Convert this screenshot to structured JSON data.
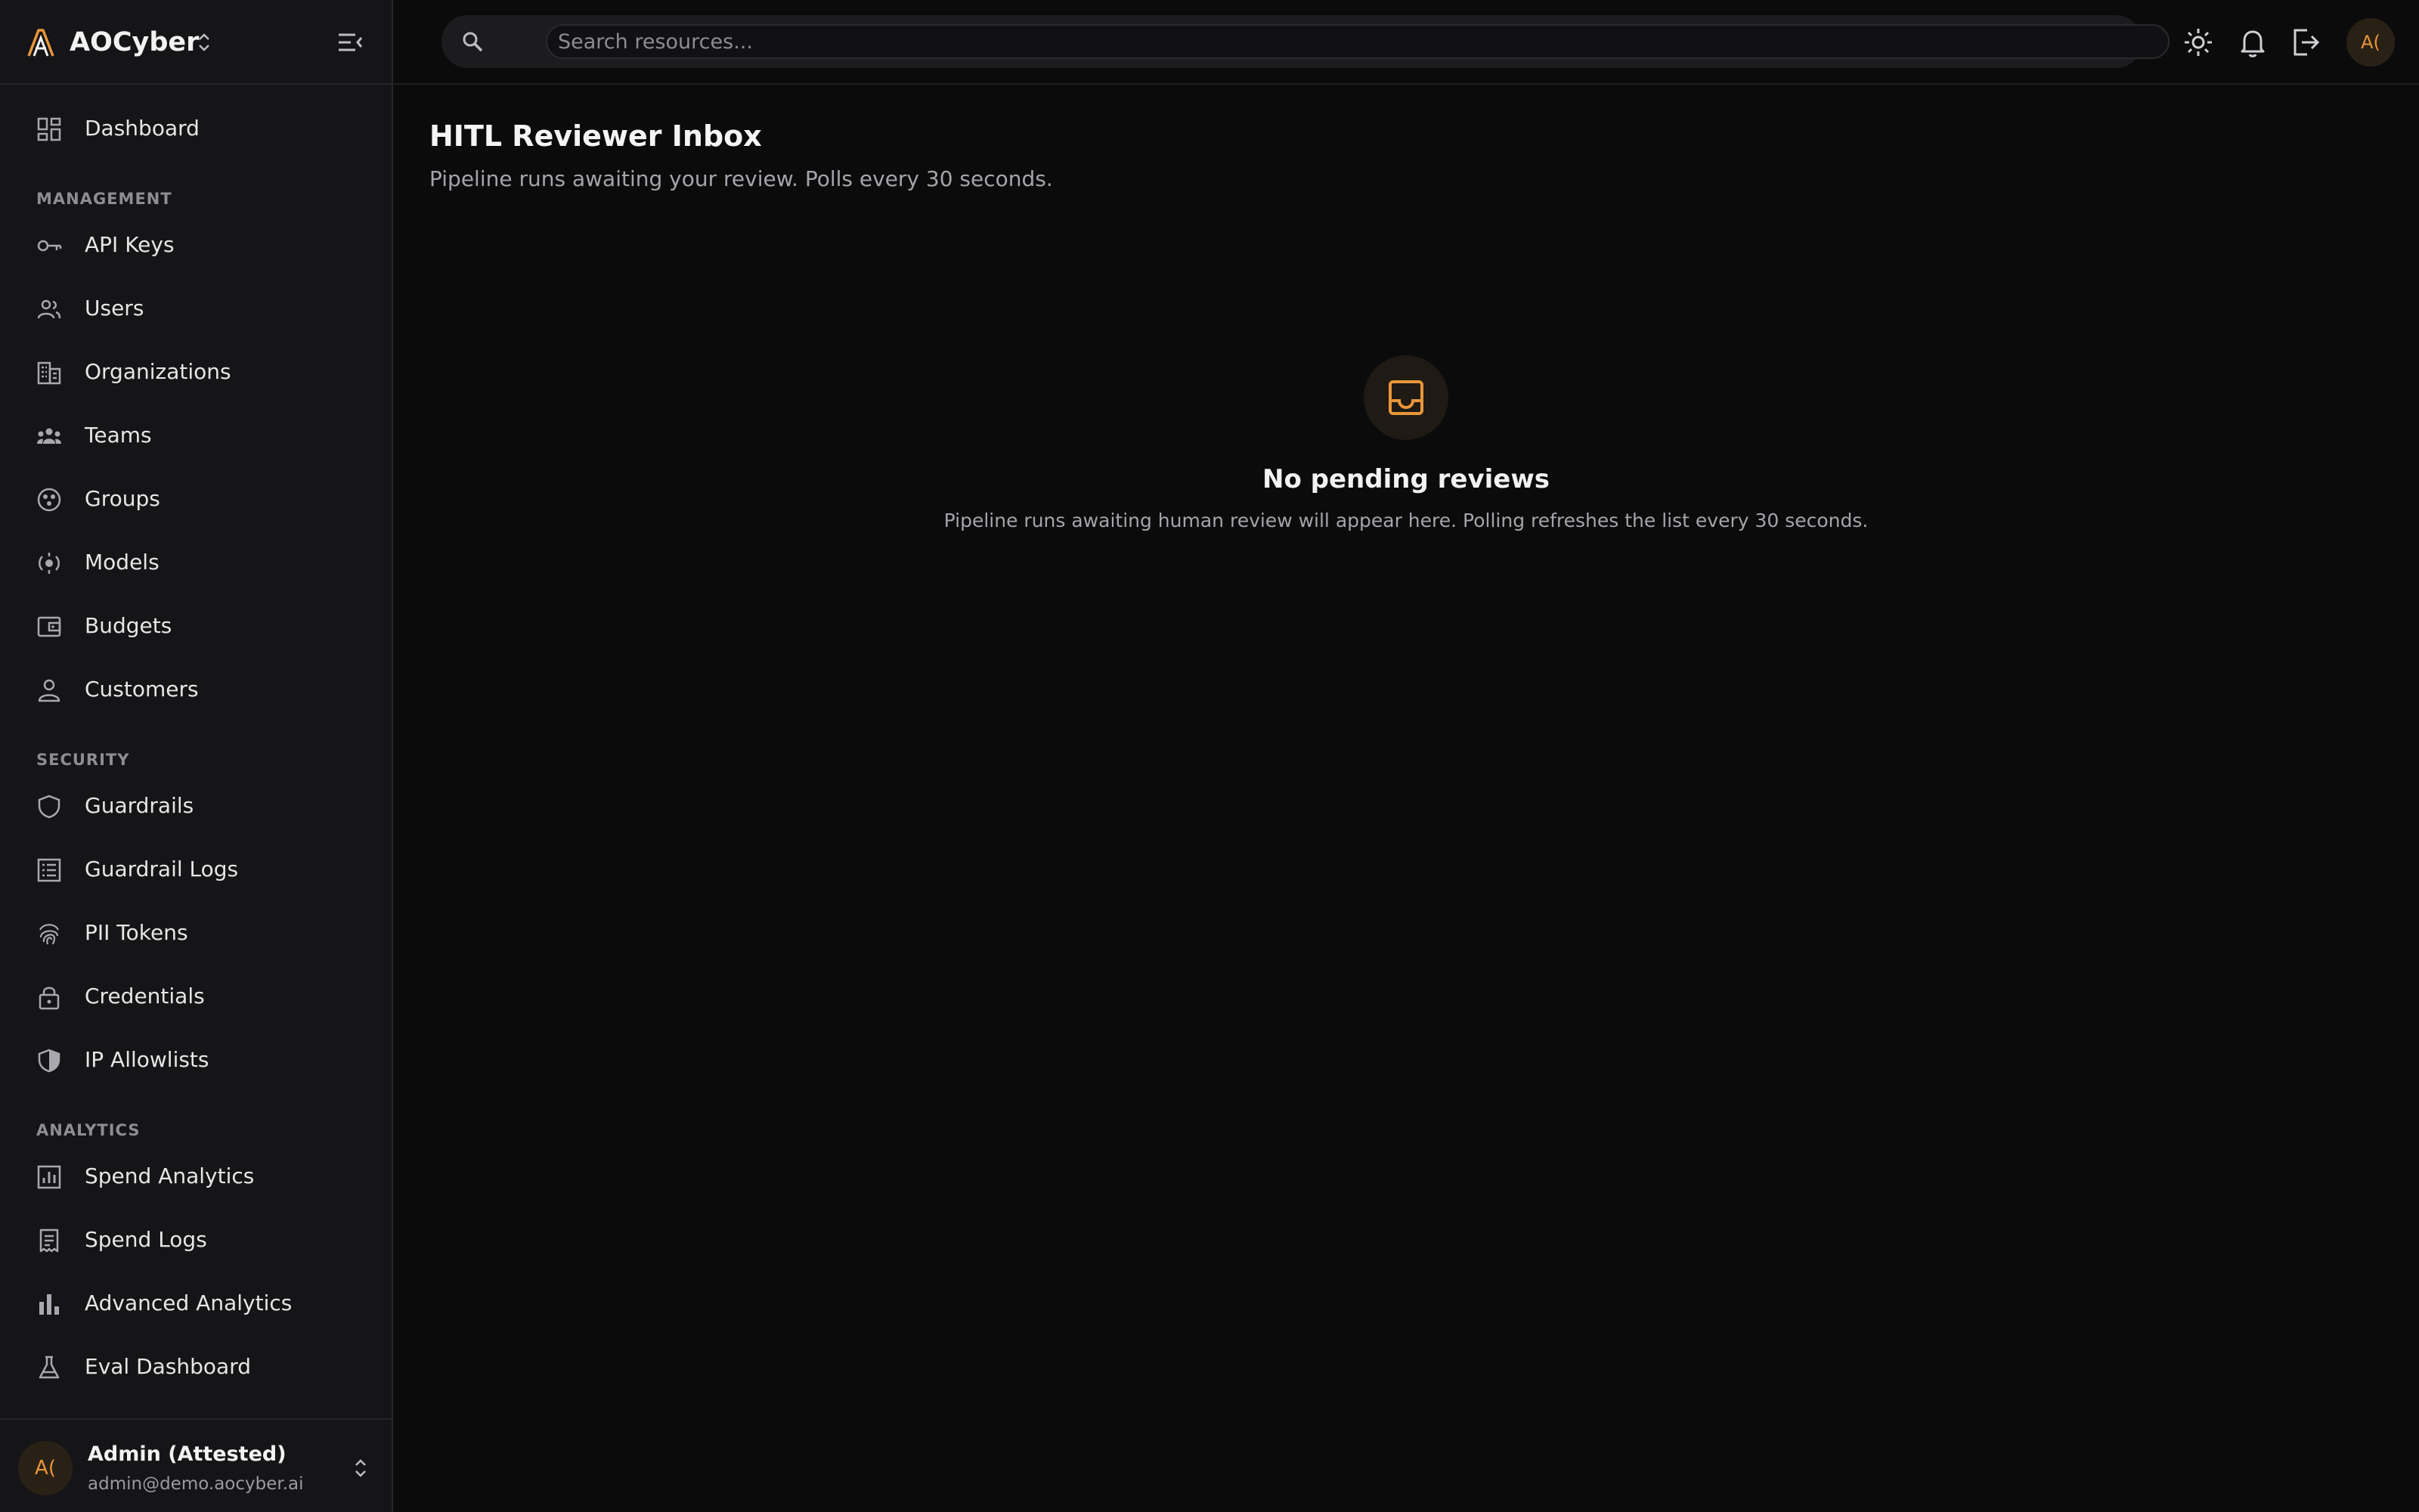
{
  "brand": {
    "name": "AOCyber"
  },
  "search": {
    "placeholder": "Search resources..."
  },
  "sidebar": {
    "top_item": {
      "label": "Dashboard",
      "icon": "dashboard-icon"
    },
    "sections": [
      {
        "label": "MANAGEMENT",
        "items": [
          {
            "label": "API Keys",
            "icon": "key-icon"
          },
          {
            "label": "Users",
            "icon": "users-icon"
          },
          {
            "label": "Organizations",
            "icon": "building-icon"
          },
          {
            "label": "Teams",
            "icon": "teams-icon"
          },
          {
            "label": "Groups",
            "icon": "groups-icon"
          },
          {
            "label": "Models",
            "icon": "models-icon"
          },
          {
            "label": "Budgets",
            "icon": "wallet-icon"
          },
          {
            "label": "Customers",
            "icon": "person-icon"
          }
        ]
      },
      {
        "label": "SECURITY",
        "items": [
          {
            "label": "Guardrails",
            "icon": "shield-icon"
          },
          {
            "label": "Guardrail Logs",
            "icon": "list-icon"
          },
          {
            "label": "PII Tokens",
            "icon": "fingerprint-icon"
          },
          {
            "label": "Credentials",
            "icon": "lock-icon"
          },
          {
            "label": "IP Allowlists",
            "icon": "shield-half-icon"
          }
        ]
      },
      {
        "label": "ANALYTICS",
        "items": [
          {
            "label": "Spend Analytics",
            "icon": "chart-box-icon"
          },
          {
            "label": "Spend Logs",
            "icon": "receipt-icon"
          },
          {
            "label": "Advanced Analytics",
            "icon": "bar-chart-icon"
          },
          {
            "label": "Eval Dashboard",
            "icon": "flask-icon"
          }
        ]
      }
    ]
  },
  "user": {
    "initials": "A(",
    "name": "Admin (Attested)",
    "email": "admin@demo.aocyber.ai"
  },
  "topbar": {
    "avatar_initials": "A("
  },
  "page": {
    "title": "HITL Reviewer Inbox",
    "subtitle": "Pipeline runs awaiting your review. Polls every 30 seconds."
  },
  "empty_state": {
    "icon": "inbox-icon",
    "title": "No pending reviews",
    "description": "Pipeline runs awaiting human review will appear here. Polling refreshes the list every 30 seconds."
  },
  "colors": {
    "accent": "#e8963a",
    "background": "#0b0b0c",
    "sidebar": "#151517"
  }
}
